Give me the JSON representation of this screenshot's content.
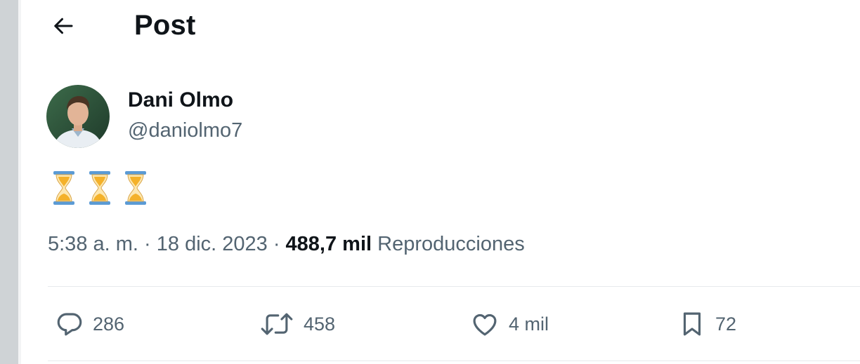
{
  "header": {
    "back_icon": "arrow-left-icon",
    "title": "Post"
  },
  "author": {
    "name": "Dani Olmo",
    "handle": "@daniolmo7"
  },
  "post": {
    "content_icons": [
      "hourglass-icon",
      "hourglass-icon",
      "hourglass-icon"
    ]
  },
  "meta": {
    "time": "5:38 a. m.",
    "separator": "·",
    "date": "18 dic. 2023",
    "views_count": "488,7 mil",
    "views_label": "Reproducciones"
  },
  "actions": {
    "replies": "286",
    "reposts": "458",
    "likes": "4 mil",
    "bookmarks": "72"
  },
  "colors": {
    "text_primary": "#0f1419",
    "text_secondary": "#536471",
    "divider": "#e6eaed",
    "hourglass_sand": "#f4b12a",
    "hourglass_cap": "#5b9bd5"
  }
}
